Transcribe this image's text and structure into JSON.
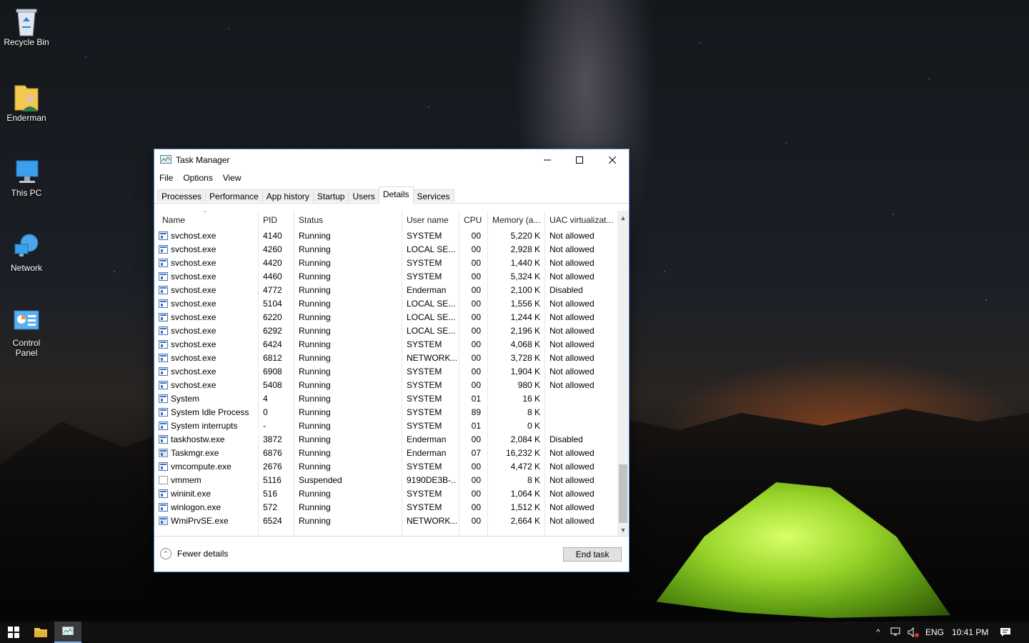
{
  "desktop": {
    "icons": [
      {
        "label": "Recycle Bin",
        "icon": "recycle-bin-icon"
      },
      {
        "label": "Enderman",
        "icon": "user-folder-icon"
      },
      {
        "label": "This PC",
        "icon": "computer-icon"
      },
      {
        "label": "Network",
        "icon": "network-icon"
      },
      {
        "label": "Control\nPanel",
        "icon": "control-panel-icon"
      }
    ]
  },
  "window": {
    "title": "Task Manager",
    "menu": [
      "File",
      "Options",
      "View"
    ],
    "tabs": [
      "Processes",
      "Performance",
      "App history",
      "Startup",
      "Users",
      "Details",
      "Services"
    ],
    "active_tab": "Details",
    "columns": [
      "Name",
      "PID",
      "Status",
      "User name",
      "CPU",
      "Memory (a...",
      "UAC virtualizat..."
    ],
    "rows": [
      {
        "name": "svchost.exe",
        "pid": "4140",
        "status": "Running",
        "user": "SYSTEM",
        "cpu": "00",
        "mem": "5,220 K",
        "uac": "Not allowed",
        "icon": "svc"
      },
      {
        "name": "svchost.exe",
        "pid": "4260",
        "status": "Running",
        "user": "LOCAL SE...",
        "cpu": "00",
        "mem": "2,928 K",
        "uac": "Not allowed",
        "icon": "svc"
      },
      {
        "name": "svchost.exe",
        "pid": "4420",
        "status": "Running",
        "user": "SYSTEM",
        "cpu": "00",
        "mem": "1,440 K",
        "uac": "Not allowed",
        "icon": "svc"
      },
      {
        "name": "svchost.exe",
        "pid": "4460",
        "status": "Running",
        "user": "SYSTEM",
        "cpu": "00",
        "mem": "5,324 K",
        "uac": "Not allowed",
        "icon": "svc"
      },
      {
        "name": "svchost.exe",
        "pid": "4772",
        "status": "Running",
        "user": "Enderman",
        "cpu": "00",
        "mem": "2,100 K",
        "uac": "Disabled",
        "icon": "svc"
      },
      {
        "name": "svchost.exe",
        "pid": "5104",
        "status": "Running",
        "user": "LOCAL SE...",
        "cpu": "00",
        "mem": "1,556 K",
        "uac": "Not allowed",
        "icon": "svc"
      },
      {
        "name": "svchost.exe",
        "pid": "6220",
        "status": "Running",
        "user": "LOCAL SE...",
        "cpu": "00",
        "mem": "1,244 K",
        "uac": "Not allowed",
        "icon": "svc"
      },
      {
        "name": "svchost.exe",
        "pid": "6292",
        "status": "Running",
        "user": "LOCAL SE...",
        "cpu": "00",
        "mem": "2,196 K",
        "uac": "Not allowed",
        "icon": "svc"
      },
      {
        "name": "svchost.exe",
        "pid": "6424",
        "status": "Running",
        "user": "SYSTEM",
        "cpu": "00",
        "mem": "4,068 K",
        "uac": "Not allowed",
        "icon": "svc"
      },
      {
        "name": "svchost.exe",
        "pid": "6812",
        "status": "Running",
        "user": "NETWORK...",
        "cpu": "00",
        "mem": "3,728 K",
        "uac": "Not allowed",
        "icon": "svc"
      },
      {
        "name": "svchost.exe",
        "pid": "6908",
        "status": "Running",
        "user": "SYSTEM",
        "cpu": "00",
        "mem": "1,904 K",
        "uac": "Not allowed",
        "icon": "svc"
      },
      {
        "name": "svchost.exe",
        "pid": "5408",
        "status": "Running",
        "user": "SYSTEM",
        "cpu": "00",
        "mem": "980 K",
        "uac": "Not allowed",
        "icon": "svc"
      },
      {
        "name": "System",
        "pid": "4",
        "status": "Running",
        "user": "SYSTEM",
        "cpu": "01",
        "mem": "16 K",
        "uac": "",
        "icon": "svc"
      },
      {
        "name": "System Idle Process",
        "pid": "0",
        "status": "Running",
        "user": "SYSTEM",
        "cpu": "89",
        "mem": "8 K",
        "uac": "",
        "icon": "svc"
      },
      {
        "name": "System interrupts",
        "pid": "-",
        "status": "Running",
        "user": "SYSTEM",
        "cpu": "01",
        "mem": "0 K",
        "uac": "",
        "icon": "svc"
      },
      {
        "name": "taskhostw.exe",
        "pid": "3872",
        "status": "Running",
        "user": "Enderman",
        "cpu": "00",
        "mem": "2,084 K",
        "uac": "Disabled",
        "icon": "svc"
      },
      {
        "name": "Taskmgr.exe",
        "pid": "6876",
        "status": "Running",
        "user": "Enderman",
        "cpu": "07",
        "mem": "16,232 K",
        "uac": "Not allowed",
        "icon": "tm"
      },
      {
        "name": "vmcompute.exe",
        "pid": "2676",
        "status": "Running",
        "user": "SYSTEM",
        "cpu": "00",
        "mem": "4,472 K",
        "uac": "Not allowed",
        "icon": "svc"
      },
      {
        "name": "vmmem",
        "pid": "5116",
        "status": "Suspended",
        "user": "9190DE3B-...",
        "cpu": "00",
        "mem": "8 K",
        "uac": "Not allowed",
        "icon": "doc"
      },
      {
        "name": "wininit.exe",
        "pid": "516",
        "status": "Running",
        "user": "SYSTEM",
        "cpu": "00",
        "mem": "1,064 K",
        "uac": "Not allowed",
        "icon": "svc"
      },
      {
        "name": "winlogon.exe",
        "pid": "572",
        "status": "Running",
        "user": "SYSTEM",
        "cpu": "00",
        "mem": "1,512 K",
        "uac": "Not allowed",
        "icon": "svc"
      },
      {
        "name": "WmiPrvSE.exe",
        "pid": "6524",
        "status": "Running",
        "user": "NETWORK...",
        "cpu": "00",
        "mem": "2,664 K",
        "uac": "Not allowed",
        "icon": "tm"
      }
    ],
    "fewer_details": "Fewer details",
    "end_task": "End task"
  },
  "taskbar": {
    "language": "ENG",
    "time": "10:41 PM"
  }
}
